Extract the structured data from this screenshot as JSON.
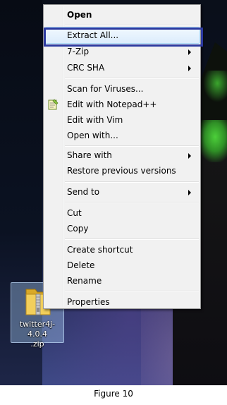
{
  "menu": {
    "open": "Open",
    "extract_all": "Extract All...",
    "seven_zip": "7-Zip",
    "crc_sha": "CRC SHA",
    "scan_for_viruses": "Scan for Viruses...",
    "edit_with_notepad": "Edit with Notepad++",
    "edit_with_vim": "Edit with Vim",
    "open_with": "Open with...",
    "share_with": "Share with",
    "restore_previous_versions": "Restore previous versions",
    "send_to": "Send to",
    "cut": "Cut",
    "copy": "Copy",
    "create_shortcut": "Create shortcut",
    "delete": "Delete",
    "rename": "Rename",
    "properties": "Properties"
  },
  "desktop": {
    "file_name_line1": "twitter4j-4.0.4",
    "file_name_line2": ".zip",
    "file_icon": "zip-folder-icon"
  },
  "caption": "Figure 10",
  "colors": {
    "annotation_border": "#2d3aa0",
    "menu_background": "#f1f1f1",
    "highlight": "#dcecfc"
  }
}
